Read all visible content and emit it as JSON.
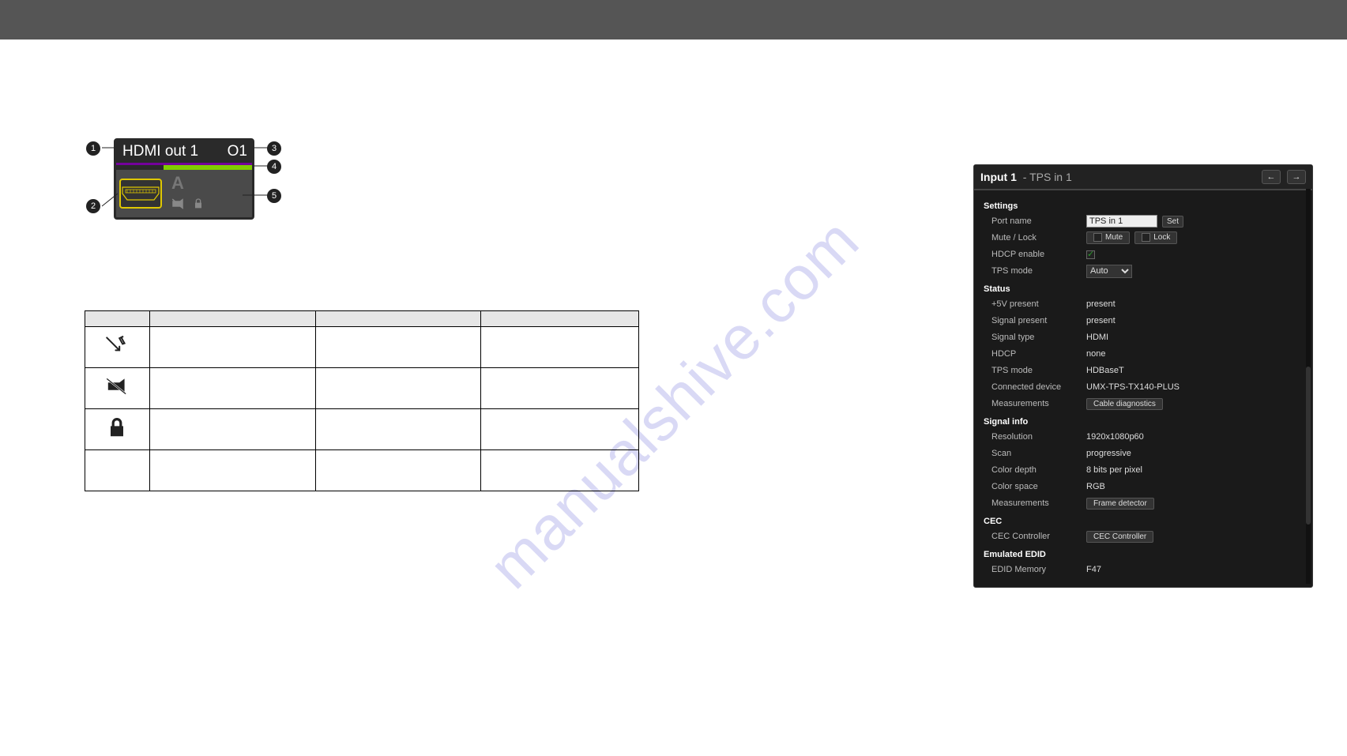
{
  "watermark": "manualshive.com",
  "tile": {
    "name": "HDMI out 1",
    "code": "O1",
    "callouts": [
      "1",
      "2",
      "3",
      "4",
      "5"
    ]
  },
  "panel": {
    "title_bold": "Input 1",
    "title_rest": " - TPS in 1",
    "nav_prev": "←",
    "nav_next": "→",
    "sections": {
      "settings_label": "Settings",
      "status_label": "Status",
      "signalinfo_label": "Signal info",
      "cec_label": "CEC",
      "edid_label": "Emulated EDID"
    },
    "settings": {
      "port_name_label": "Port name",
      "port_name_value": "TPS in 1",
      "set_btn": "Set",
      "mutelock_label": "Mute / Lock",
      "mute_btn": "Mute",
      "lock_btn": "Lock",
      "hdcp_label": "HDCP enable",
      "hdcp_on": true,
      "tps_label": "TPS mode",
      "tps_value": "Auto"
    },
    "status": {
      "rows": [
        {
          "label": "+5V present",
          "value": "present"
        },
        {
          "label": "Signal present",
          "value": "present"
        },
        {
          "label": "Signal type",
          "value": "HDMI"
        },
        {
          "label": "HDCP",
          "value": "none"
        },
        {
          "label": "TPS mode",
          "value": "HDBaseT"
        },
        {
          "label": "Connected device",
          "value": "UMX-TPS-TX140-PLUS"
        }
      ],
      "meas_label": "Measurements",
      "cable_btn": "Cable diagnostics"
    },
    "signalinfo": {
      "rows": [
        {
          "label": "Resolution",
          "value": "1920x1080p60"
        },
        {
          "label": "Scan",
          "value": "progressive"
        },
        {
          "label": "Color depth",
          "value": "8 bits per pixel"
        },
        {
          "label": "Color space",
          "value": "RGB"
        }
      ],
      "meas_label": "Measurements",
      "frame_btn": "Frame detector"
    },
    "cec": {
      "label": "CEC Controller",
      "btn": "CEC Controller"
    },
    "edid": {
      "label": "EDID Memory",
      "value": "F47"
    }
  }
}
